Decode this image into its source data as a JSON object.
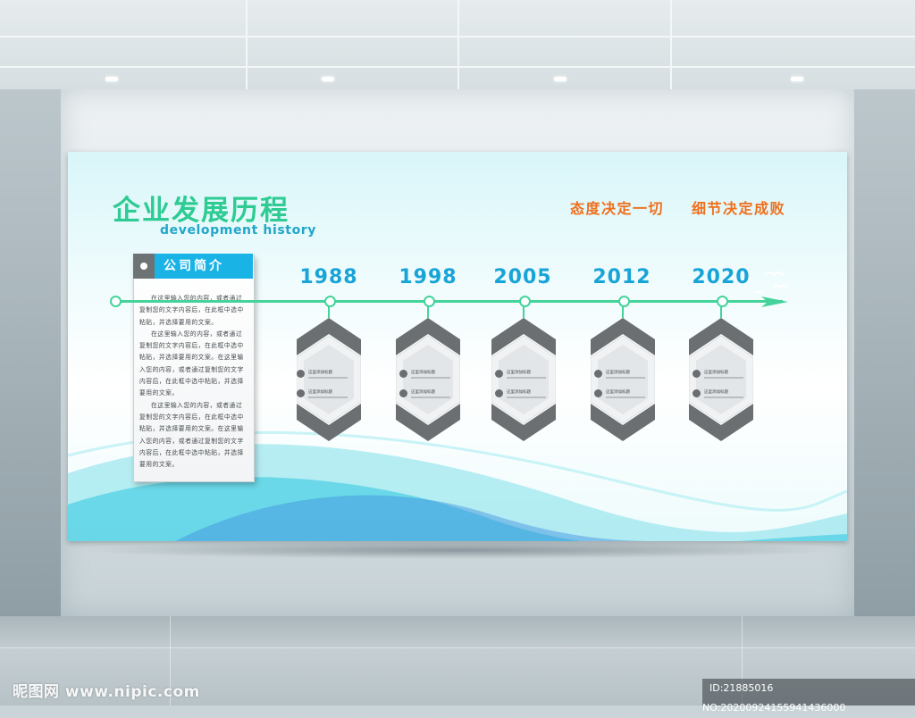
{
  "board": {
    "title_cn": "企业发展历程",
    "title_en": "development history",
    "slogan_1": "态度决定一切",
    "slogan_2": "细节决定成败",
    "accent_green": "#2ecb93",
    "accent_blue": "#1ab3e6",
    "accent_orange": "#ef6f1c"
  },
  "intro": {
    "heading": "公司简介",
    "paragraphs": [
      "在这里输入您的内容，或者通过复制您的文字内容后，在此框中选中粘贴，并选择要用的文案。",
      "在这里输入您的内容，或者通过复制您的文字内容后，在此框中选中粘贴，并选择要用的文案。在这里输入您的内容，或者通过复制您的文字内容后，在此框中选中粘贴，并选择要用的文案。",
      "在这里输入您的内容，或者通过复制您的文字内容后，在此框中选中粘贴，并选择要用的文案。在这里输入您的内容，或者通过复制您的文字内容后，在此框中选中粘贴，并选择要用的文案。"
    ]
  },
  "timeline": [
    {
      "year": "1988",
      "entry_1": "这里添加标题",
      "entry_2": "这里添加标题"
    },
    {
      "year": "1998",
      "entry_1": "这里添加标题",
      "entry_2": "这里添加标题"
    },
    {
      "year": "2005",
      "entry_1": "这里添加标题",
      "entry_2": "这里添加标题"
    },
    {
      "year": "2012",
      "entry_1": "这里添加标题",
      "entry_2": "这里添加标题"
    },
    {
      "year": "2020",
      "entry_1": "这里添加标题",
      "entry_2": "这里添加标题"
    }
  ],
  "watermark": {
    "brand": "昵图网 www.nipic.com",
    "id_text": "ID:21885016 NO:20200924155941436000"
  }
}
